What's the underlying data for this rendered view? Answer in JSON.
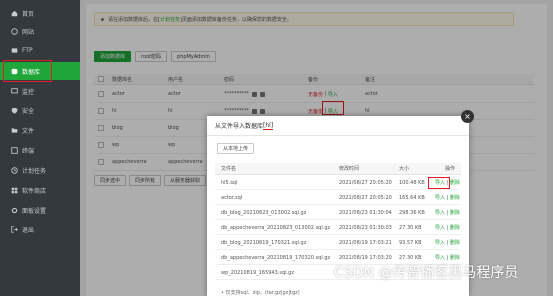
{
  "sidebar": {
    "items": [
      {
        "label": "首页",
        "icon": "home-icon"
      },
      {
        "label": "网站",
        "icon": "globe-icon"
      },
      {
        "label": "FTP",
        "icon": "ftp-icon"
      },
      {
        "label": "数据库",
        "icon": "database-icon",
        "active": true
      },
      {
        "label": "监控",
        "icon": "monitor-icon"
      },
      {
        "label": "安全",
        "icon": "shield-icon"
      },
      {
        "label": "文件",
        "icon": "folder-icon"
      },
      {
        "label": "终端",
        "icon": "terminal-icon"
      },
      {
        "label": "计划任务",
        "icon": "clock-icon"
      },
      {
        "label": "软件商店",
        "icon": "store-icon"
      },
      {
        "label": "面板设置",
        "icon": "gear-icon"
      },
      {
        "label": "退出",
        "icon": "logout-icon"
      }
    ]
  },
  "notice": {
    "before": "请在添加数据库后，在[",
    "link": "计划任务",
    "after": "]页面添加数据库备份任务，以确保您的数据安全。"
  },
  "toolbar": {
    "add_label": "添加数据库",
    "root_label": "root密码",
    "pma_label": "phpMyAdmin"
  },
  "table": {
    "headers": [
      "数据库名",
      "用户名",
      "密码",
      "备份",
      "备注"
    ],
    "rows": [
      {
        "name": "actor",
        "user": "actor",
        "password": "**********",
        "backup": "无备份",
        "import": "导入",
        "note": "actor"
      },
      {
        "name": "hl",
        "user": "hl",
        "password": "**********",
        "backup": "无备份",
        "import": "导入",
        "note": "hl"
      },
      {
        "name": "blog",
        "user": "blog",
        "password": "**********",
        "backup": "",
        "import": "",
        "note": ""
      },
      {
        "name": "wp",
        "user": "wp",
        "password": "**********",
        "backup": "",
        "import": "",
        "note": ""
      },
      {
        "name": "appecheverra",
        "user": "appecheverra",
        "password": "",
        "backup": "",
        "import": "",
        "note": ""
      }
    ]
  },
  "bottom_buttons": [
    "同步选中",
    "同步所有",
    "从服务器获取"
  ],
  "dialog": {
    "title_prefix": "从文件导入数据库",
    "title_db": "[hl]",
    "close": "×",
    "upload_label": "从本地上传",
    "headers": [
      "文件名",
      "修改时间",
      "大小",
      "操作"
    ],
    "files": [
      {
        "name": "hl5.sql",
        "time": "2021/08/27 20:05:20",
        "size": "100.48 KB",
        "import": "导入",
        "delete": "删除"
      },
      {
        "name": "actor.sql",
        "time": "2021/08/27 20:05:20",
        "size": "165.64 KB",
        "import": "导入",
        "delete": "删除"
      },
      {
        "name": "db_blog_20210823_013002.sql.gz",
        "time": "2021/08/23 01:30:04",
        "size": "298.36 KB",
        "import": "导入",
        "delete": "删除"
      },
      {
        "name": "db_appecheverra_20210823_013002.sql.gz",
        "time": "2021/08/23 01:30:03",
        "size": "27.30 KB",
        "import": "导入",
        "delete": "删除"
      },
      {
        "name": "db_blog_20210819_170321.sql.gz",
        "time": "2021/08/19 17:03:21",
        "size": "93.57 KB",
        "import": "导入",
        "delete": "删除"
      },
      {
        "name": "db_appecheverra_20210819_170320.sql.gz",
        "time": "2021/08/19 17:03:20",
        "size": "27.30 KB",
        "import": "导入",
        "delete": "删除"
      },
      {
        "name": "wp_20210819_165943.sql.gz",
        "time": "",
        "size": "",
        "import": "",
        "delete": ""
      }
    ],
    "footer": "• 仅支持sql、zip、(tar.gz|gz|tgz)"
  },
  "watermark": "CSDN @传智播客黑马程序员",
  "colors": {
    "accent": "#20a53a",
    "highlight": "#e02020",
    "sidebar": "#33393d"
  }
}
